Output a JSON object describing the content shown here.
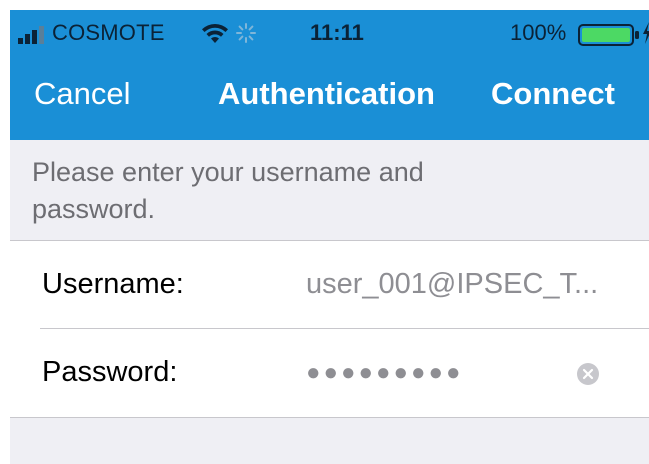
{
  "status_bar": {
    "carrier": "COSMOTE",
    "time": "11:11",
    "battery_percent": "100%",
    "icons": [
      "signal-icon",
      "wifi-icon",
      "activity-spinner-icon",
      "battery-icon",
      "charging-icon"
    ],
    "battery_level": 1.0,
    "battery_color": "#4cd964"
  },
  "nav": {
    "cancel_label": "Cancel",
    "title": "Authentication",
    "connect_label": "Connect",
    "background_color": "#1a8fd6"
  },
  "prompt": {
    "text": "Please enter your username and password."
  },
  "form": {
    "username_label": "Username:",
    "username_value": "user_001@IPSEC_T...",
    "password_label": "Password:",
    "password_value": "●●●●●●●●●",
    "clear_icon": "clear-icon"
  }
}
